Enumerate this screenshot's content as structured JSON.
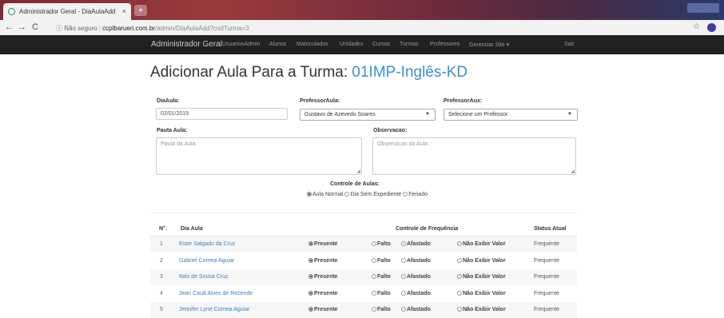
{
  "browser": {
    "tab_title": "Administrador Geral - DiaAulaAdd",
    "tab_close": "×",
    "new_tab": "+",
    "url_security": "Não seguro",
    "url_host": "ccplbarueri.com.br",
    "url_path": "/admin/DiaAulaAdd?codTurma=3"
  },
  "navbar": {
    "brand": "Administrador Geral",
    "items": [
      "UsuariosAdmin",
      "Alunos",
      "Matriculados",
      "Unidades",
      "Cursos",
      "Turmas",
      "Professores",
      "Gerenciar Site ▾"
    ],
    "logout": "Sair"
  },
  "page": {
    "title_prefix": "Adicionar Aula Para a Turma:",
    "title_turma": "01IMP-Inglês-KD"
  },
  "form": {
    "dia_aula_label": "DiaAula:",
    "dia_aula_value": "02/01/2019",
    "professor_label": "ProfessorAula:",
    "professor_value": "Gustavo de Azevedo Soares",
    "professor_aux_label": "ProfessorAux:",
    "professor_aux_value": "Selecione um Professor",
    "pauta_label": "Pauta Aula:",
    "pauta_placeholder": "Pauta da Aula",
    "observacao_label": "Observacao:",
    "observacao_placeholder": "Observacao da Aula",
    "controle_label": "Controle de Aulas:",
    "controle_options": [
      "Aula Normal",
      "Dia Sem Expediente",
      "Feriado"
    ],
    "controle_selected": "Aula Normal"
  },
  "table": {
    "headers": {
      "num": "N°.",
      "dia_aula": "Dia Aula",
      "controle": "Controle de Frequência",
      "status": "Status Atual"
    },
    "options": [
      "Presente",
      "Falto",
      "Afastado",
      "Não Exibir Valor"
    ],
    "rows": [
      {
        "num": "1",
        "name": "Ester Salgado da Cruz",
        "selected": "Presente",
        "status": "Frequente"
      },
      {
        "num": "2",
        "name": "Gabriel Correia Aguiar",
        "selected": "Presente",
        "status": "Frequente"
      },
      {
        "num": "3",
        "name": "Italo de Sousa Cruz",
        "selected": "Presente",
        "status": "Frequente"
      },
      {
        "num": "4",
        "name": "Jean Cauã Alves de Rezende",
        "selected": "Presente",
        "status": "Frequente"
      },
      {
        "num": "5",
        "name": "Jennifer Lyne Correia Aguiar",
        "selected": "Presente",
        "status": "Frequente"
      }
    ]
  },
  "colors": {
    "navbar_bg": "#222222",
    "link": "#3a7fc0",
    "title_accent": "#3a8fd4"
  }
}
